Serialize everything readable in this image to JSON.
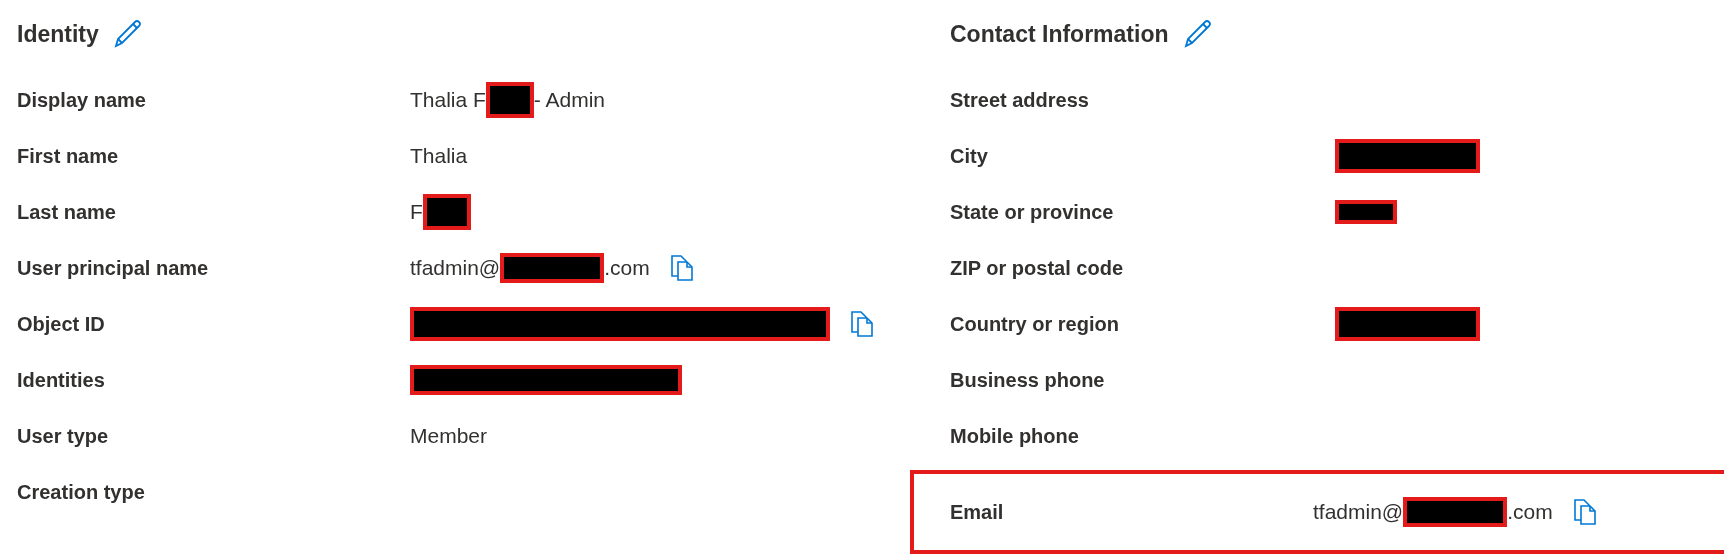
{
  "sections": [
    {
      "title": "Identity",
      "fields": [
        {
          "label": "Display name",
          "value": [
            {
              "kind": "text",
              "text": "Thalia F"
            },
            {
              "kind": "redacted"
            },
            {
              "kind": "text",
              "text": "- Admin"
            }
          ]
        },
        {
          "label": "First name",
          "value": [
            {
              "kind": "text",
              "text": "Thalia"
            }
          ]
        },
        {
          "label": "Last name",
          "value": [
            {
              "kind": "text",
              "text": "F"
            },
            {
              "kind": "redacted"
            }
          ]
        },
        {
          "label": "User principal name",
          "value": [
            {
              "kind": "text",
              "text": "tfadmin@"
            },
            {
              "kind": "redacted"
            },
            {
              "kind": "text",
              "text": ".com"
            }
          ],
          "copyable": true
        },
        {
          "label": "Object ID",
          "value": [
            {
              "kind": "redacted"
            }
          ],
          "copyable": true
        },
        {
          "label": "Identities",
          "value": [
            {
              "kind": "redacted"
            }
          ]
        },
        {
          "label": "User type",
          "value": [
            {
              "kind": "text",
              "text": "Member"
            }
          ]
        },
        {
          "label": "Creation type"
        }
      ]
    },
    {
      "title": "Contact Information",
      "fields": [
        {
          "label": "Street address"
        },
        {
          "label": "City",
          "value": [
            {
              "kind": "redacted"
            }
          ]
        },
        {
          "label": "State or province",
          "value": [
            {
              "kind": "redacted"
            }
          ]
        },
        {
          "label": "ZIP or postal code"
        },
        {
          "label": "Country or region",
          "value": [
            {
              "kind": "redacted"
            }
          ]
        },
        {
          "label": "Business phone"
        },
        {
          "label": "Mobile phone"
        },
        {
          "label": "Email",
          "value": [
            {
              "kind": "text",
              "text": "tfadmin@"
            },
            {
              "kind": "redacted"
            },
            {
              "kind": "text",
              "text": ".com"
            }
          ],
          "copyable": true,
          "highlighted": true
        }
      ]
    }
  ]
}
